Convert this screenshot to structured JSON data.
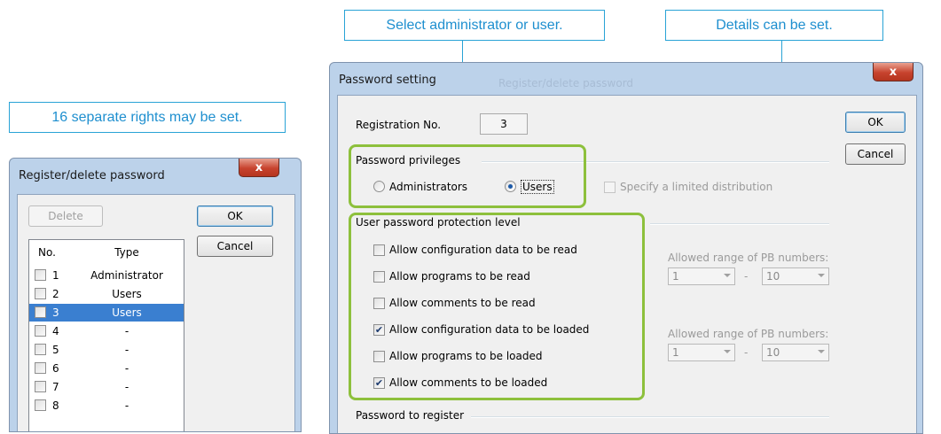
{
  "callouts": {
    "left": "16 separate rights may be set.",
    "top1": "Select administrator or user.",
    "top2": "Details can be set."
  },
  "register_dialog": {
    "title": "Register/delete password",
    "close_label": "x",
    "delete_label": "Delete",
    "ok_label": "OK",
    "cancel_label": "Cancel",
    "columns": {
      "no": "No.",
      "type": "Type"
    },
    "rows": [
      {
        "no": "1",
        "type": "Administrator",
        "selected": false
      },
      {
        "no": "2",
        "type": "Users",
        "selected": false
      },
      {
        "no": "3",
        "type": "Users",
        "selected": true
      },
      {
        "no": "4",
        "type": "-",
        "selected": false
      },
      {
        "no": "5",
        "type": "-",
        "selected": false
      },
      {
        "no": "6",
        "type": "-",
        "selected": false
      },
      {
        "no": "7",
        "type": "-",
        "selected": false
      },
      {
        "no": "8",
        "type": "-",
        "selected": false
      }
    ]
  },
  "password_dialog": {
    "title": "Password setting",
    "close_label": "x",
    "ok_label": "OK",
    "cancel_label": "Cancel",
    "registration_label": "Registration No.",
    "registration_value": "3",
    "privileges_label": "Password privileges",
    "administrators_label": "Administrators",
    "users_label": "Users",
    "selected_privilege": "Users",
    "limited_distribution_label": "Specify a limited distribution",
    "protection_label": "User password protection level",
    "permissions": [
      {
        "label": "Allow configuration data to be read",
        "checked": false
      },
      {
        "label": "Allow programs to be read",
        "checked": false
      },
      {
        "label": "Allow comments to be read",
        "checked": false
      },
      {
        "label": "Allow configuration data to be loaded",
        "checked": true
      },
      {
        "label": "Allow programs to be loaded",
        "checked": false
      },
      {
        "label": "Allow comments to be loaded",
        "checked": true
      }
    ],
    "pb_range_label_1": "Allowed range of PB numbers:",
    "pb_range_label_2": "Allowed range of PB numbers:",
    "pb_from_1": "1",
    "pb_to_1": "10",
    "pb_from_2": "1",
    "pb_to_2": "10",
    "pb_dash": "-",
    "register_label": "Password to register",
    "background_dialog_title": "Register/delete password"
  }
}
